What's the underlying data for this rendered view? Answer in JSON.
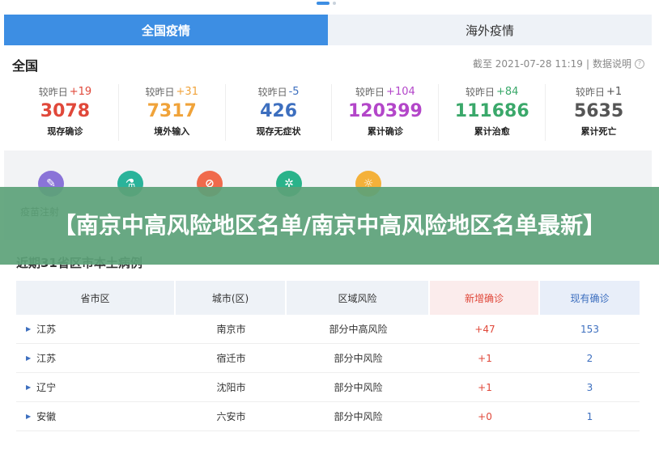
{
  "tabs": [
    {
      "label": "全国疫情",
      "active": true
    },
    {
      "label": "海外疫情",
      "active": false
    }
  ],
  "national": {
    "title": "全国",
    "timestamp": "截至 2021-07-28 11:19",
    "info_link": "数据说明"
  },
  "stats": [
    {
      "delta_label": "较昨日",
      "delta": "+19",
      "value": "3078",
      "label": "现存确诊",
      "color": "#e0483a"
    },
    {
      "delta_label": "较昨日",
      "delta": "+31",
      "value": "7317",
      "label": "境外输入",
      "color": "#f0a33a"
    },
    {
      "delta_label": "较昨日",
      "delta": "-5",
      "value": "426",
      "label": "现存无症状",
      "color": "#3d6fbf"
    },
    {
      "delta_label": "较昨日",
      "delta": "+104",
      "value": "120399",
      "label": "累计确诊",
      "color": "#b346c9"
    },
    {
      "delta_label": "较昨日",
      "delta": "+84",
      "value": "111686",
      "label": "累计治愈",
      "color": "#3aa86a"
    },
    {
      "delta_label": "较昨日",
      "delta": "+1",
      "value": "5635",
      "label": "累计死亡",
      "color": "#555555"
    }
  ],
  "quick_links": [
    {
      "icon": "syringe-icon",
      "text": "疫苗注射",
      "color": "#8a73d8"
    },
    {
      "icon": "flask-icon",
      "text": "",
      "color": "#2ab39a"
    },
    {
      "icon": "ban-icon",
      "text": "",
      "color": "#f06a4c"
    },
    {
      "icon": "virus-icon",
      "text": "",
      "color": "#2ab38a"
    },
    {
      "icon": "bulb-icon",
      "text": "",
      "color": "#f4b13a"
    }
  ],
  "banner": {
    "text": "【南京中高风险地区名单/南京中高风险地区名单最新】"
  },
  "section": {
    "title": "近期31省区市本土病例"
  },
  "table": {
    "headers": [
      "省市区",
      "城市(区)",
      "区域风险",
      "新增确诊",
      "现有确诊"
    ],
    "rows": [
      {
        "province": "江苏",
        "city": "南京市",
        "risk": "部分中高风险",
        "new": "+47",
        "current": "153"
      },
      {
        "province": "江苏",
        "city": "宿迁市",
        "risk": "部分中风险",
        "new": "+1",
        "current": "2"
      },
      {
        "province": "辽宁",
        "city": "沈阳市",
        "risk": "部分中风险",
        "new": "+1",
        "current": "3"
      },
      {
        "province": "安徽",
        "city": "六安市",
        "risk": "部分中风险",
        "new": "+0",
        "current": "1"
      }
    ]
  }
}
